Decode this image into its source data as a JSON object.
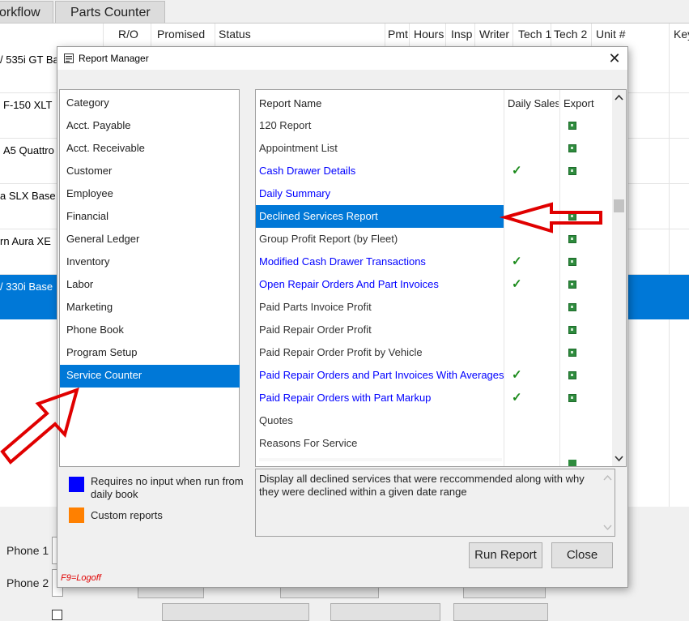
{
  "background": {
    "tabs": [
      "orkflow",
      "Parts Counter"
    ],
    "columns": [
      "R/O",
      "Promised",
      "Status",
      "Pmt",
      "Hours",
      "Insp",
      "Writer",
      "Tech 1",
      "Tech 2",
      "Unit #",
      "Key"
    ],
    "rows": [
      "/ 535i GT Ba",
      "F-150 XLT",
      "A5 Quattro",
      "a  SLX Base",
      "rn  Aura XE",
      "/ 330i Base"
    ],
    "phone1_label": "Phone 1",
    "phone2_label": "Phone 2"
  },
  "dialog": {
    "title": "Report Manager",
    "close_symbol": "✕",
    "category_header": "Category",
    "categories": [
      "Acct. Payable",
      "Acct. Receivable",
      "Customer",
      "Employee",
      "Financial",
      "General Ledger",
      "Inventory",
      "Labor",
      "Marketing",
      "Phone Book",
      "Program Setup",
      "Service Counter"
    ],
    "selected_category": "Service Counter",
    "report_columns": {
      "name": "Report Name",
      "daily": "Daily Sales",
      "export": "Export"
    },
    "reports": [
      {
        "name": "120 Report",
        "color": "dark",
        "daily": false,
        "export": true
      },
      {
        "name": "Appointment List",
        "color": "dark",
        "daily": false,
        "export": true
      },
      {
        "name": "Cash Drawer Details",
        "color": "blue",
        "daily": true,
        "export": true
      },
      {
        "name": "Daily Summary",
        "color": "blue",
        "daily": false,
        "export": false
      },
      {
        "name": "Declined Services Report",
        "color": "selected",
        "daily": false,
        "export": true
      },
      {
        "name": "Group Profit Report (by Fleet)",
        "color": "dark",
        "daily": false,
        "export": true
      },
      {
        "name": "Modified Cash Drawer Transactions",
        "color": "blue",
        "daily": true,
        "export": true
      },
      {
        "name": "Open Repair Orders And Part Invoices",
        "color": "blue",
        "daily": true,
        "export": true
      },
      {
        "name": "Paid Parts Invoice Profit",
        "color": "dark",
        "daily": false,
        "export": true
      },
      {
        "name": "Paid Repair Order Profit",
        "color": "dark",
        "daily": false,
        "export": true
      },
      {
        "name": "Paid Repair Order Profit by Vehicle",
        "color": "dark",
        "daily": false,
        "export": true
      },
      {
        "name": "Paid Repair Orders and Part Invoices With Averages",
        "color": "blue",
        "daily": true,
        "export": true
      },
      {
        "name": "Paid Repair Orders with Part Markup",
        "color": "blue",
        "daily": true,
        "export": true
      },
      {
        "name": "Quotes",
        "color": "dark",
        "daily": false,
        "export": false
      },
      {
        "name": "Reasons For Service",
        "color": "dark",
        "daily": false,
        "export": false
      }
    ],
    "check_symbol": "✓",
    "legend": [
      {
        "color": "#0000ff",
        "text_line1": "Requires no input when run from",
        "text_line2": "daily book"
      },
      {
        "color": "#ff8000",
        "text_line1": "Custom reports",
        "text_line2": ""
      }
    ],
    "description": "Display all declined services that were reccommended along with why they were declined within a given date range",
    "run_button": "Run Report",
    "close_button": "Close",
    "logoff_hint": "F9=Logoff"
  },
  "colors": {
    "selection": "#0078d7",
    "arrow": "#e00000"
  }
}
